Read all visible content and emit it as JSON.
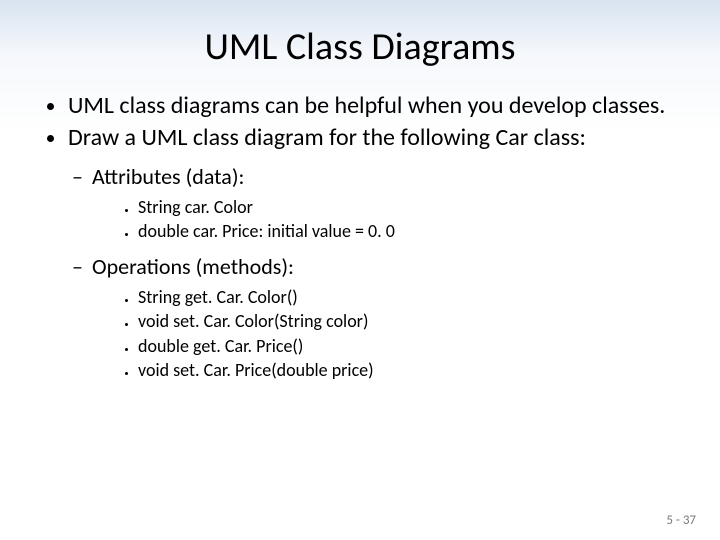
{
  "title": "UML Class Diagrams",
  "bullets": {
    "b1": "UML class diagrams can  be helpful when you develop classes.",
    "b2": "Draw a UML class diagram for the following Car class:"
  },
  "attr_header": "Attributes (data):",
  "attrs": {
    "a1": "String car. Color",
    "a2": "double car. Price: initial value = 0. 0"
  },
  "ops_header": "Operations (methods):",
  "ops": {
    "o1": "String get. Car. Color()",
    "o2": "void set. Car. Color(String color)",
    "o3": "double get. Car. Price()",
    "o4": "void set. Car. Price(double price)"
  },
  "pagenum": "5 - 37"
}
